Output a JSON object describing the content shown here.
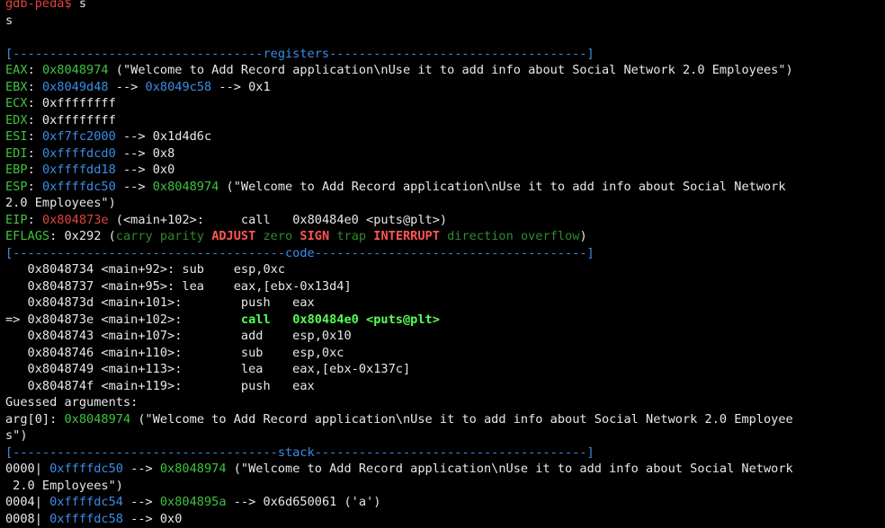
{
  "window": {
    "title": "gdb-peda terminal"
  },
  "colors": {
    "default": "#e8e8e8",
    "red": "#e0443e",
    "green": "#3fc33f",
    "blue": "#3a8ee6",
    "bright_red": "#ff5555",
    "bright_green": "#55ff55",
    "dark_green": "#2e8b2e"
  },
  "terminal": {
    "lines": [
      [
        {
          "t": "gdb-peda$ ",
          "c": "red"
        },
        {
          "t": "s",
          "c": "default"
        }
      ],
      [
        {
          "t": "s",
          "c": "default"
        }
      ],
      [
        {
          "t": "",
          "c": "default"
        }
      ],
      [
        {
          "t": "[----------------------------------registers-----------------------------------]",
          "c": "blue"
        }
      ],
      [
        {
          "t": "EAX",
          "c": "green"
        },
        {
          "t": ": ",
          "c": "default"
        },
        {
          "t": "0x8048974",
          "c": "green"
        },
        {
          "t": " (\"Welcome to Add Record application\\nUse it to add info about Social Network 2.0 Employees\")",
          "c": "default"
        }
      ],
      [
        {
          "t": "EBX",
          "c": "green"
        },
        {
          "t": ": ",
          "c": "default"
        },
        {
          "t": "0x8049d48",
          "c": "blue"
        },
        {
          "t": " --> ",
          "c": "default"
        },
        {
          "t": "0x8049c58",
          "c": "blue"
        },
        {
          "t": " --> 0x1",
          "c": "default"
        }
      ],
      [
        {
          "t": "ECX",
          "c": "green"
        },
        {
          "t": ": 0xffffffff",
          "c": "default"
        }
      ],
      [
        {
          "t": "EDX",
          "c": "green"
        },
        {
          "t": ": 0xffffffff",
          "c": "default"
        }
      ],
      [
        {
          "t": "ESI",
          "c": "green"
        },
        {
          "t": ": ",
          "c": "default"
        },
        {
          "t": "0xf7fc2000",
          "c": "blue"
        },
        {
          "t": " --> 0x1d4d6c",
          "c": "default"
        }
      ],
      [
        {
          "t": "EDI",
          "c": "green"
        },
        {
          "t": ": ",
          "c": "default"
        },
        {
          "t": "0xffffdcd0",
          "c": "blue"
        },
        {
          "t": " --> 0x8",
          "c": "default"
        }
      ],
      [
        {
          "t": "EBP",
          "c": "green"
        },
        {
          "t": ": ",
          "c": "default"
        },
        {
          "t": "0xffffdd18",
          "c": "blue"
        },
        {
          "t": " --> 0x0",
          "c": "default"
        }
      ],
      [
        {
          "t": "ESP",
          "c": "green"
        },
        {
          "t": ": ",
          "c": "default"
        },
        {
          "t": "0xffffdc50",
          "c": "blue"
        },
        {
          "t": " --> ",
          "c": "default"
        },
        {
          "t": "0x8048974",
          "c": "green"
        },
        {
          "t": " (\"Welcome to Add Record application\\nUse it to add info about Social Network",
          "c": "default"
        }
      ],
      [
        {
          "t": "2.0 Employees\")",
          "c": "default"
        }
      ],
      [
        {
          "t": "EIP",
          "c": "green"
        },
        {
          "t": ": ",
          "c": "default"
        },
        {
          "t": "0x804873e",
          "c": "red"
        },
        {
          "t": " (<main+102>:     call   0x80484e0 <puts@plt>)",
          "c": "default"
        }
      ],
      [
        {
          "t": "EFLAGS",
          "c": "green"
        },
        {
          "t": ": 0x292 (",
          "c": "default"
        },
        {
          "t": "carry parity ",
          "c": "dark_green"
        },
        {
          "t": "ADJUST",
          "c": "bright_red",
          "b": true
        },
        {
          "t": " zero ",
          "c": "dark_green"
        },
        {
          "t": "SIGN",
          "c": "bright_red",
          "b": true
        },
        {
          "t": " trap ",
          "c": "dark_green"
        },
        {
          "t": "INTERRUPT",
          "c": "bright_red",
          "b": true
        },
        {
          "t": " direction overflow",
          "c": "dark_green"
        },
        {
          "t": ")",
          "c": "default"
        }
      ],
      [
        {
          "t": "[-------------------------------------code-------------------------------------]",
          "c": "blue"
        }
      ],
      [
        {
          "t": "   0x8048734 <main+92>: sub    esp,0xc",
          "c": "default"
        }
      ],
      [
        {
          "t": "   0x8048737 <main+95>: lea    eax,[ebx-0x13d4]",
          "c": "default"
        }
      ],
      [
        {
          "t": "   0x804873d <main+101>:        push   eax",
          "c": "default"
        }
      ],
      [
        {
          "t": "=> 0x804873e <main+102>:        ",
          "c": "default"
        },
        {
          "t": "call   0x80484e0 <puts@plt>",
          "c": "bright_green",
          "b": true
        }
      ],
      [
        {
          "t": "   0x8048743 <main+107>:        add    esp,0x10",
          "c": "default"
        }
      ],
      [
        {
          "t": "   0x8048746 <main+110>:        sub    esp,0xc",
          "c": "default"
        }
      ],
      [
        {
          "t": "   0x8048749 <main+113>:        lea    eax,[ebx-0x137c]",
          "c": "default"
        }
      ],
      [
        {
          "t": "   0x804874f <main+119>:        push   eax",
          "c": "default"
        }
      ],
      [
        {
          "t": "Guessed arguments:",
          "c": "default"
        }
      ],
      [
        {
          "t": "arg[0]: ",
          "c": "default"
        },
        {
          "t": "0x8048974",
          "c": "green"
        },
        {
          "t": " (\"Welcome to Add Record application\\nUse it to add info about Social Network 2.0 Employee",
          "c": "default"
        }
      ],
      [
        {
          "t": "s\")",
          "c": "default"
        }
      ],
      [
        {
          "t": "[------------------------------------stack-------------------------------------]",
          "c": "blue"
        }
      ],
      [
        {
          "t": "0000| ",
          "c": "default"
        },
        {
          "t": "0xffffdc50",
          "c": "blue"
        },
        {
          "t": " --> ",
          "c": "default"
        },
        {
          "t": "0x8048974",
          "c": "green"
        },
        {
          "t": " (\"Welcome to Add Record application\\nUse it to add info about Social Network",
          "c": "default"
        }
      ],
      [
        {
          "t": " 2.0 Employees\")",
          "c": "default"
        }
      ],
      [
        {
          "t": "0004| ",
          "c": "default"
        },
        {
          "t": "0xffffdc54",
          "c": "blue"
        },
        {
          "t": " --> ",
          "c": "default"
        },
        {
          "t": "0x804895a",
          "c": "green"
        },
        {
          "t": " --> 0x6d650061 ('a')",
          "c": "default"
        }
      ],
      [
        {
          "t": "0008| ",
          "c": "default"
        },
        {
          "t": "0xffffdc58",
          "c": "blue"
        },
        {
          "t": " --> 0x0",
          "c": "default"
        }
      ]
    ]
  }
}
